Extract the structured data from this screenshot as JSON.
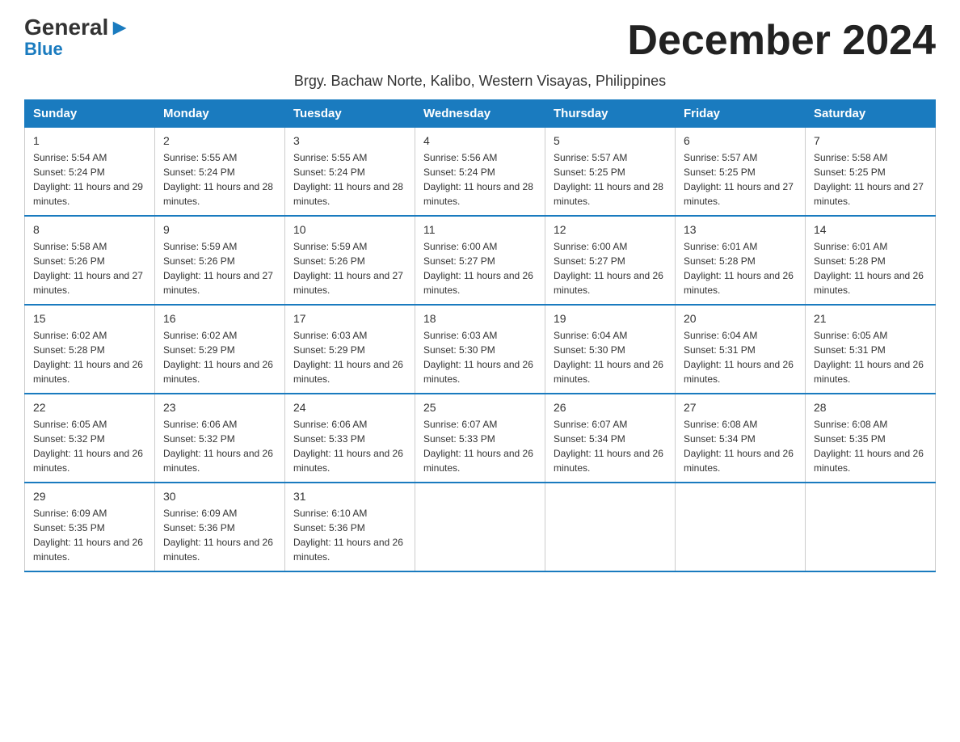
{
  "logo": {
    "part1": "General",
    "part2": "Blue"
  },
  "title": "December 2024",
  "subtitle": "Brgy. Bachaw Norte, Kalibo, Western Visayas, Philippines",
  "days_header": [
    "Sunday",
    "Monday",
    "Tuesday",
    "Wednesday",
    "Thursday",
    "Friday",
    "Saturday"
  ],
  "weeks": [
    [
      {
        "day": "1",
        "sunrise": "5:54 AM",
        "sunset": "5:24 PM",
        "daylight": "11 hours and 29 minutes."
      },
      {
        "day": "2",
        "sunrise": "5:55 AM",
        "sunset": "5:24 PM",
        "daylight": "11 hours and 28 minutes."
      },
      {
        "day": "3",
        "sunrise": "5:55 AM",
        "sunset": "5:24 PM",
        "daylight": "11 hours and 28 minutes."
      },
      {
        "day": "4",
        "sunrise": "5:56 AM",
        "sunset": "5:24 PM",
        "daylight": "11 hours and 28 minutes."
      },
      {
        "day": "5",
        "sunrise": "5:57 AM",
        "sunset": "5:25 PM",
        "daylight": "11 hours and 28 minutes."
      },
      {
        "day": "6",
        "sunrise": "5:57 AM",
        "sunset": "5:25 PM",
        "daylight": "11 hours and 27 minutes."
      },
      {
        "day": "7",
        "sunrise": "5:58 AM",
        "sunset": "5:25 PM",
        "daylight": "11 hours and 27 minutes."
      }
    ],
    [
      {
        "day": "8",
        "sunrise": "5:58 AM",
        "sunset": "5:26 PM",
        "daylight": "11 hours and 27 minutes."
      },
      {
        "day": "9",
        "sunrise": "5:59 AM",
        "sunset": "5:26 PM",
        "daylight": "11 hours and 27 minutes."
      },
      {
        "day": "10",
        "sunrise": "5:59 AM",
        "sunset": "5:26 PM",
        "daylight": "11 hours and 27 minutes."
      },
      {
        "day": "11",
        "sunrise": "6:00 AM",
        "sunset": "5:27 PM",
        "daylight": "11 hours and 26 minutes."
      },
      {
        "day": "12",
        "sunrise": "6:00 AM",
        "sunset": "5:27 PM",
        "daylight": "11 hours and 26 minutes."
      },
      {
        "day": "13",
        "sunrise": "6:01 AM",
        "sunset": "5:28 PM",
        "daylight": "11 hours and 26 minutes."
      },
      {
        "day": "14",
        "sunrise": "6:01 AM",
        "sunset": "5:28 PM",
        "daylight": "11 hours and 26 minutes."
      }
    ],
    [
      {
        "day": "15",
        "sunrise": "6:02 AM",
        "sunset": "5:28 PM",
        "daylight": "11 hours and 26 minutes."
      },
      {
        "day": "16",
        "sunrise": "6:02 AM",
        "sunset": "5:29 PM",
        "daylight": "11 hours and 26 minutes."
      },
      {
        "day": "17",
        "sunrise": "6:03 AM",
        "sunset": "5:29 PM",
        "daylight": "11 hours and 26 minutes."
      },
      {
        "day": "18",
        "sunrise": "6:03 AM",
        "sunset": "5:30 PM",
        "daylight": "11 hours and 26 minutes."
      },
      {
        "day": "19",
        "sunrise": "6:04 AM",
        "sunset": "5:30 PM",
        "daylight": "11 hours and 26 minutes."
      },
      {
        "day": "20",
        "sunrise": "6:04 AM",
        "sunset": "5:31 PM",
        "daylight": "11 hours and 26 minutes."
      },
      {
        "day": "21",
        "sunrise": "6:05 AM",
        "sunset": "5:31 PM",
        "daylight": "11 hours and 26 minutes."
      }
    ],
    [
      {
        "day": "22",
        "sunrise": "6:05 AM",
        "sunset": "5:32 PM",
        "daylight": "11 hours and 26 minutes."
      },
      {
        "day": "23",
        "sunrise": "6:06 AM",
        "sunset": "5:32 PM",
        "daylight": "11 hours and 26 minutes."
      },
      {
        "day": "24",
        "sunrise": "6:06 AM",
        "sunset": "5:33 PM",
        "daylight": "11 hours and 26 minutes."
      },
      {
        "day": "25",
        "sunrise": "6:07 AM",
        "sunset": "5:33 PM",
        "daylight": "11 hours and 26 minutes."
      },
      {
        "day": "26",
        "sunrise": "6:07 AM",
        "sunset": "5:34 PM",
        "daylight": "11 hours and 26 minutes."
      },
      {
        "day": "27",
        "sunrise": "6:08 AM",
        "sunset": "5:34 PM",
        "daylight": "11 hours and 26 minutes."
      },
      {
        "day": "28",
        "sunrise": "6:08 AM",
        "sunset": "5:35 PM",
        "daylight": "11 hours and 26 minutes."
      }
    ],
    [
      {
        "day": "29",
        "sunrise": "6:09 AM",
        "sunset": "5:35 PM",
        "daylight": "11 hours and 26 minutes."
      },
      {
        "day": "30",
        "sunrise": "6:09 AM",
        "sunset": "5:36 PM",
        "daylight": "11 hours and 26 minutes."
      },
      {
        "day": "31",
        "sunrise": "6:10 AM",
        "sunset": "5:36 PM",
        "daylight": "11 hours and 26 minutes."
      },
      null,
      null,
      null,
      null
    ]
  ]
}
